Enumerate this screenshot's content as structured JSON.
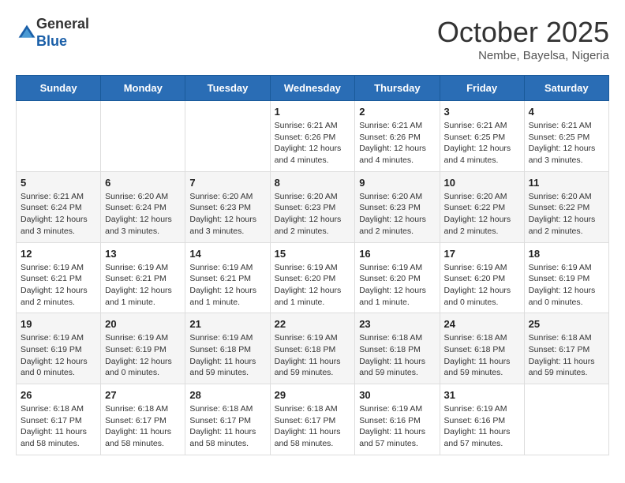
{
  "logo": {
    "general": "General",
    "blue": "Blue"
  },
  "title": "October 2025",
  "subtitle": "Nembe, Bayelsa, Nigeria",
  "days_of_week": [
    "Sunday",
    "Monday",
    "Tuesday",
    "Wednesday",
    "Thursday",
    "Friday",
    "Saturday"
  ],
  "weeks": [
    [
      {
        "day": "",
        "info": ""
      },
      {
        "day": "",
        "info": ""
      },
      {
        "day": "",
        "info": ""
      },
      {
        "day": "1",
        "info": "Sunrise: 6:21 AM\nSunset: 6:26 PM\nDaylight: 12 hours and 4 minutes."
      },
      {
        "day": "2",
        "info": "Sunrise: 6:21 AM\nSunset: 6:26 PM\nDaylight: 12 hours and 4 minutes."
      },
      {
        "day": "3",
        "info": "Sunrise: 6:21 AM\nSunset: 6:25 PM\nDaylight: 12 hours and 4 minutes."
      },
      {
        "day": "4",
        "info": "Sunrise: 6:21 AM\nSunset: 6:25 PM\nDaylight: 12 hours and 3 minutes."
      }
    ],
    [
      {
        "day": "5",
        "info": "Sunrise: 6:21 AM\nSunset: 6:24 PM\nDaylight: 12 hours and 3 minutes."
      },
      {
        "day": "6",
        "info": "Sunrise: 6:20 AM\nSunset: 6:24 PM\nDaylight: 12 hours and 3 minutes."
      },
      {
        "day": "7",
        "info": "Sunrise: 6:20 AM\nSunset: 6:23 PM\nDaylight: 12 hours and 3 minutes."
      },
      {
        "day": "8",
        "info": "Sunrise: 6:20 AM\nSunset: 6:23 PM\nDaylight: 12 hours and 2 minutes."
      },
      {
        "day": "9",
        "info": "Sunrise: 6:20 AM\nSunset: 6:23 PM\nDaylight: 12 hours and 2 minutes."
      },
      {
        "day": "10",
        "info": "Sunrise: 6:20 AM\nSunset: 6:22 PM\nDaylight: 12 hours and 2 minutes."
      },
      {
        "day": "11",
        "info": "Sunrise: 6:20 AM\nSunset: 6:22 PM\nDaylight: 12 hours and 2 minutes."
      }
    ],
    [
      {
        "day": "12",
        "info": "Sunrise: 6:19 AM\nSunset: 6:21 PM\nDaylight: 12 hours and 2 minutes."
      },
      {
        "day": "13",
        "info": "Sunrise: 6:19 AM\nSunset: 6:21 PM\nDaylight: 12 hours and 1 minute."
      },
      {
        "day": "14",
        "info": "Sunrise: 6:19 AM\nSunset: 6:21 PM\nDaylight: 12 hours and 1 minute."
      },
      {
        "day": "15",
        "info": "Sunrise: 6:19 AM\nSunset: 6:20 PM\nDaylight: 12 hours and 1 minute."
      },
      {
        "day": "16",
        "info": "Sunrise: 6:19 AM\nSunset: 6:20 PM\nDaylight: 12 hours and 1 minute."
      },
      {
        "day": "17",
        "info": "Sunrise: 6:19 AM\nSunset: 6:20 PM\nDaylight: 12 hours and 0 minutes."
      },
      {
        "day": "18",
        "info": "Sunrise: 6:19 AM\nSunset: 6:19 PM\nDaylight: 12 hours and 0 minutes."
      }
    ],
    [
      {
        "day": "19",
        "info": "Sunrise: 6:19 AM\nSunset: 6:19 PM\nDaylight: 12 hours and 0 minutes."
      },
      {
        "day": "20",
        "info": "Sunrise: 6:19 AM\nSunset: 6:19 PM\nDaylight: 12 hours and 0 minutes."
      },
      {
        "day": "21",
        "info": "Sunrise: 6:19 AM\nSunset: 6:18 PM\nDaylight: 11 hours and 59 minutes."
      },
      {
        "day": "22",
        "info": "Sunrise: 6:19 AM\nSunset: 6:18 PM\nDaylight: 11 hours and 59 minutes."
      },
      {
        "day": "23",
        "info": "Sunrise: 6:18 AM\nSunset: 6:18 PM\nDaylight: 11 hours and 59 minutes."
      },
      {
        "day": "24",
        "info": "Sunrise: 6:18 AM\nSunset: 6:18 PM\nDaylight: 11 hours and 59 minutes."
      },
      {
        "day": "25",
        "info": "Sunrise: 6:18 AM\nSunset: 6:17 PM\nDaylight: 11 hours and 59 minutes."
      }
    ],
    [
      {
        "day": "26",
        "info": "Sunrise: 6:18 AM\nSunset: 6:17 PM\nDaylight: 11 hours and 58 minutes."
      },
      {
        "day": "27",
        "info": "Sunrise: 6:18 AM\nSunset: 6:17 PM\nDaylight: 11 hours and 58 minutes."
      },
      {
        "day": "28",
        "info": "Sunrise: 6:18 AM\nSunset: 6:17 PM\nDaylight: 11 hours and 58 minutes."
      },
      {
        "day": "29",
        "info": "Sunrise: 6:18 AM\nSunset: 6:17 PM\nDaylight: 11 hours and 58 minutes."
      },
      {
        "day": "30",
        "info": "Sunrise: 6:19 AM\nSunset: 6:16 PM\nDaylight: 11 hours and 57 minutes."
      },
      {
        "day": "31",
        "info": "Sunrise: 6:19 AM\nSunset: 6:16 PM\nDaylight: 11 hours and 57 minutes."
      },
      {
        "day": "",
        "info": ""
      }
    ]
  ]
}
